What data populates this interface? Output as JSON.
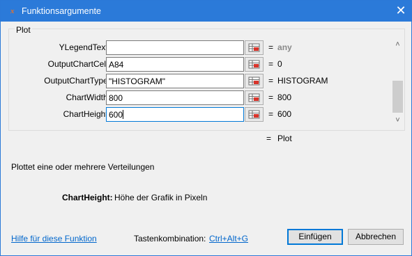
{
  "window": {
    "title": "Funktionsargumente",
    "app_icon": "x",
    "close_glyph": "✕"
  },
  "group": {
    "label": "Plot"
  },
  "args": [
    {
      "label": "YLegendText:",
      "value": "",
      "eq": "=",
      "result": "any",
      "result_style": "gray"
    },
    {
      "label": "OutputChartCell:",
      "value": "A84",
      "eq": "=",
      "result": "0"
    },
    {
      "label": "OutputChartType:",
      "value": "\"HISTOGRAM\"",
      "eq": "=",
      "result": "HISTOGRAM"
    },
    {
      "label": "ChartWidth:",
      "value": "800",
      "eq": "=",
      "result": "800"
    },
    {
      "label": "ChartHeight:",
      "value": "600",
      "eq": "=",
      "result": "600"
    }
  ],
  "scrollbar": {
    "up_glyph": "˄",
    "down_glyph": "˅"
  },
  "function_result": {
    "eq": "=",
    "value": "Plot"
  },
  "description": "Plottet eine oder mehrere Verteilungen",
  "argument_help": {
    "name": "ChartHeight:",
    "text": "Höhe der Grafik in Pixeln"
  },
  "footer": {
    "help_link": "Hilfe für diese Funktion",
    "shortcut_label": "Tastenkombination:",
    "shortcut_value": "Ctrl+Alt+G",
    "ok_label": "Einfügen",
    "cancel_label": "Abbrechen"
  },
  "colors": {
    "titlebar": "#2b7ad9",
    "link": "#0066cc",
    "focus": "#0078d7"
  }
}
